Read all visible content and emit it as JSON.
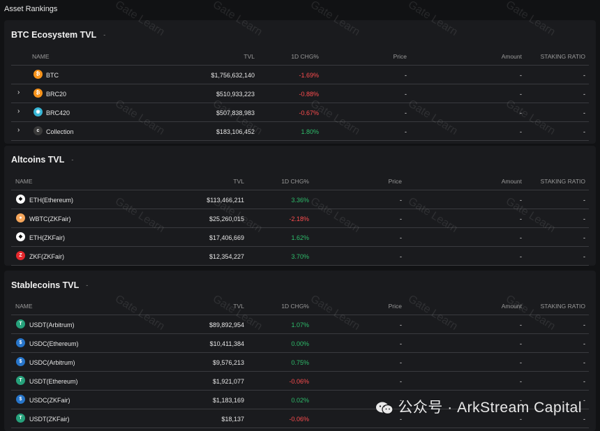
{
  "page": {
    "title": "Asset Rankings"
  },
  "columns": {
    "name": "NAME",
    "tvl": "TVL",
    "chg": "1D CHG%",
    "price": "Price",
    "amount": "Amount",
    "staking": "STAKING RATIO"
  },
  "sections": {
    "btc": {
      "title": "BTC Ecosystem TVL",
      "dash": "-",
      "rows": [
        {
          "name": "BTC",
          "tvl": "$1,756,632,140",
          "chg": "-1.69%",
          "price": "-",
          "amount": "-",
          "staking": "-",
          "icon": "bitcoin-icon",
          "color": "#f7931a"
        },
        {
          "name": "BRC20",
          "tvl": "$510,933,223",
          "chg": "-0.88%",
          "price": "-",
          "amount": "-",
          "staking": "-",
          "icon": "brc20-icon",
          "color": "#f7931a"
        },
        {
          "name": "BRC420",
          "tvl": "$507,838,983",
          "chg": "-0.67%",
          "price": "-",
          "amount": "-",
          "staking": "-",
          "icon": "brc420-icon",
          "color": "#37b6d6"
        },
        {
          "name": "Collection",
          "tvl": "$183,106,452",
          "chg": "1.80%",
          "price": "-",
          "amount": "-",
          "staking": "-",
          "icon": "collection-icon",
          "color": "#3a3a3a"
        }
      ]
    },
    "alt": {
      "title": "Altcoins TVL",
      "dash": "-",
      "rows": [
        {
          "name": "ETH(Ethereum)",
          "tvl": "$113,466,211",
          "chg": "3.36%",
          "price": "-",
          "amount": "-",
          "staking": "-",
          "icon": "ethereum-icon",
          "color": "#ffffff"
        },
        {
          "name": "WBTC(ZKFair)",
          "tvl": "$25,260,015",
          "chg": "-2.18%",
          "price": "-",
          "amount": "-",
          "staking": "-",
          "icon": "wbtc-icon",
          "color": "#f5a65b"
        },
        {
          "name": "ETH(ZKFair)",
          "tvl": "$17,406,669",
          "chg": "1.62%",
          "price": "-",
          "amount": "-",
          "staking": "-",
          "icon": "ethereum-zkfair-icon",
          "color": "#ffffff"
        },
        {
          "name": "ZKF(ZKFair)",
          "tvl": "$12,354,227",
          "chg": "3.70%",
          "price": "-",
          "amount": "-",
          "staking": "-",
          "icon": "zkf-icon",
          "color": "#e5282d"
        }
      ]
    },
    "stable": {
      "title": "Stablecoins TVL",
      "dash": "-",
      "rows": [
        {
          "name": "USDT(Arbitrum)",
          "tvl": "$89,892,954",
          "chg": "1.07%",
          "price": "-",
          "amount": "-",
          "staking": "-",
          "icon": "usdt-icon",
          "color": "#26a17b"
        },
        {
          "name": "USDC(Ethereum)",
          "tvl": "$10,411,384",
          "chg": "0.00%",
          "price": "-",
          "amount": "-",
          "staking": "-",
          "icon": "usdc-icon",
          "color": "#2775ca"
        },
        {
          "name": "USDC(Arbitrum)",
          "tvl": "$9,576,213",
          "chg": "0.75%",
          "price": "-",
          "amount": "-",
          "staking": "-",
          "icon": "usdc-icon",
          "color": "#2775ca"
        },
        {
          "name": "USDT(Ethereum)",
          "tvl": "$1,921,077",
          "chg": "-0.06%",
          "price": "-",
          "amount": "-",
          "staking": "-",
          "icon": "usdt-icon",
          "color": "#26a17b"
        },
        {
          "name": "USDC(ZKFair)",
          "tvl": "$1,183,169",
          "chg": "0.02%",
          "price": "-",
          "amount": "-",
          "staking": "-",
          "icon": "usdc-icon",
          "color": "#2775ca"
        },
        {
          "name": "USDT(ZKFair)",
          "tvl": "$18,137",
          "chg": "-0.06%",
          "price": "-",
          "amount": "-",
          "staking": "-",
          "icon": "usdt-icon",
          "color": "#26a17b"
        }
      ]
    }
  },
  "watermark": {
    "text": "Gate Learn",
    "wechat": "公众号 · ArkStream Capital"
  }
}
